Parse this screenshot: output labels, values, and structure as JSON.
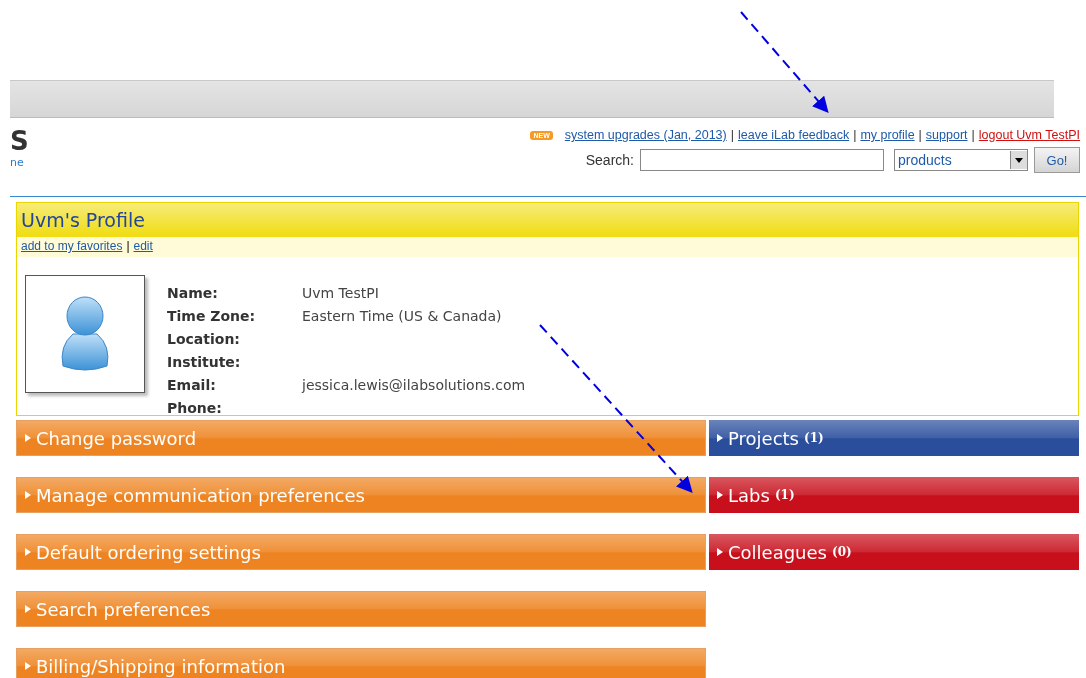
{
  "header": {
    "logo_fragment": "S",
    "tagline_fragment": "ne",
    "new_badge": "NEW",
    "separator": "|",
    "links": [
      {
        "label": "system upgrades (Jan, 2013)",
        "kind": "normal"
      },
      {
        "label": "leave iLab feedback",
        "kind": "normal"
      },
      {
        "label": "my profile",
        "kind": "normal"
      },
      {
        "label": "support",
        "kind": "normal"
      },
      {
        "label": "logout Uvm TestPI",
        "kind": "logout"
      }
    ],
    "search": {
      "label": "Search:",
      "select_value": "products",
      "button": "Go!"
    }
  },
  "profile": {
    "title": "Uvm's Profile",
    "actions": [
      "add to my favorites",
      "edit"
    ],
    "fields": [
      {
        "label": "Name:",
        "value": "Uvm TestPI"
      },
      {
        "label": "Time Zone:",
        "value": "Eastern Time (US & Canada)"
      },
      {
        "label": "Location:"
      },
      {
        "label": "Institute:"
      },
      {
        "label": "Email:",
        "value": "jessica.lewis@ilabsolutions.com"
      },
      {
        "label": "Phone:"
      }
    ]
  },
  "left_panels": [
    {
      "label": "Change password"
    },
    {
      "label": "Manage communication preferences"
    },
    {
      "label": "Default ordering settings"
    },
    {
      "label": "Search preferences"
    },
    {
      "label": "Billing/Shipping information"
    }
  ],
  "right_panels": [
    {
      "label": "Projects",
      "count": "(1)",
      "color": "#2a4e9c"
    },
    {
      "label": "Labs",
      "count": "(1)",
      "color": "#c8101c"
    },
    {
      "label": "Colleagues",
      "count": "(0)",
      "color": "#c8101c"
    }
  ]
}
